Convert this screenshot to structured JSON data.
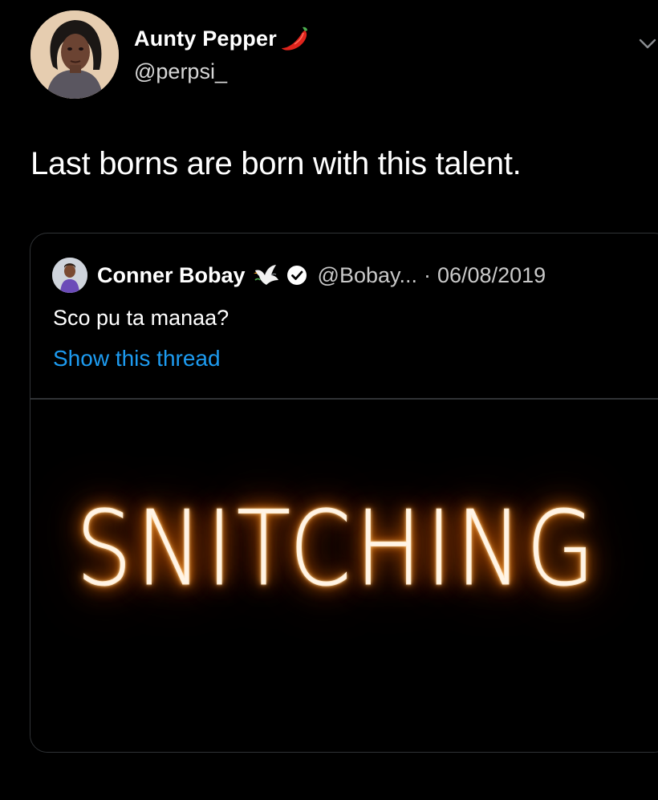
{
  "tweet": {
    "author": {
      "name": "Aunty Pepper",
      "name_emoji": "pepper-icon",
      "handle": "@perpsi_"
    },
    "menu_icon": "chevron-down-icon",
    "text": "Last borns are born with this talent."
  },
  "quote": {
    "author": {
      "name": "Conner Bobay",
      "name_emoji": "dove-icon",
      "verified_icon": "verified-icon",
      "handle": "@Bobay...",
      "separator": "·",
      "date": "06/08/2019"
    },
    "text": "Sco pu ta manaa?",
    "show_thread": "Show this thread",
    "media": {
      "text": "SNITCHING"
    }
  },
  "colors": {
    "background": "#000000",
    "primary_text": "#ffffff",
    "secondary_text": "#c9c9c9",
    "link": "#1d9bf0",
    "border": "#303336",
    "neon_glow": "#ff7a00"
  }
}
